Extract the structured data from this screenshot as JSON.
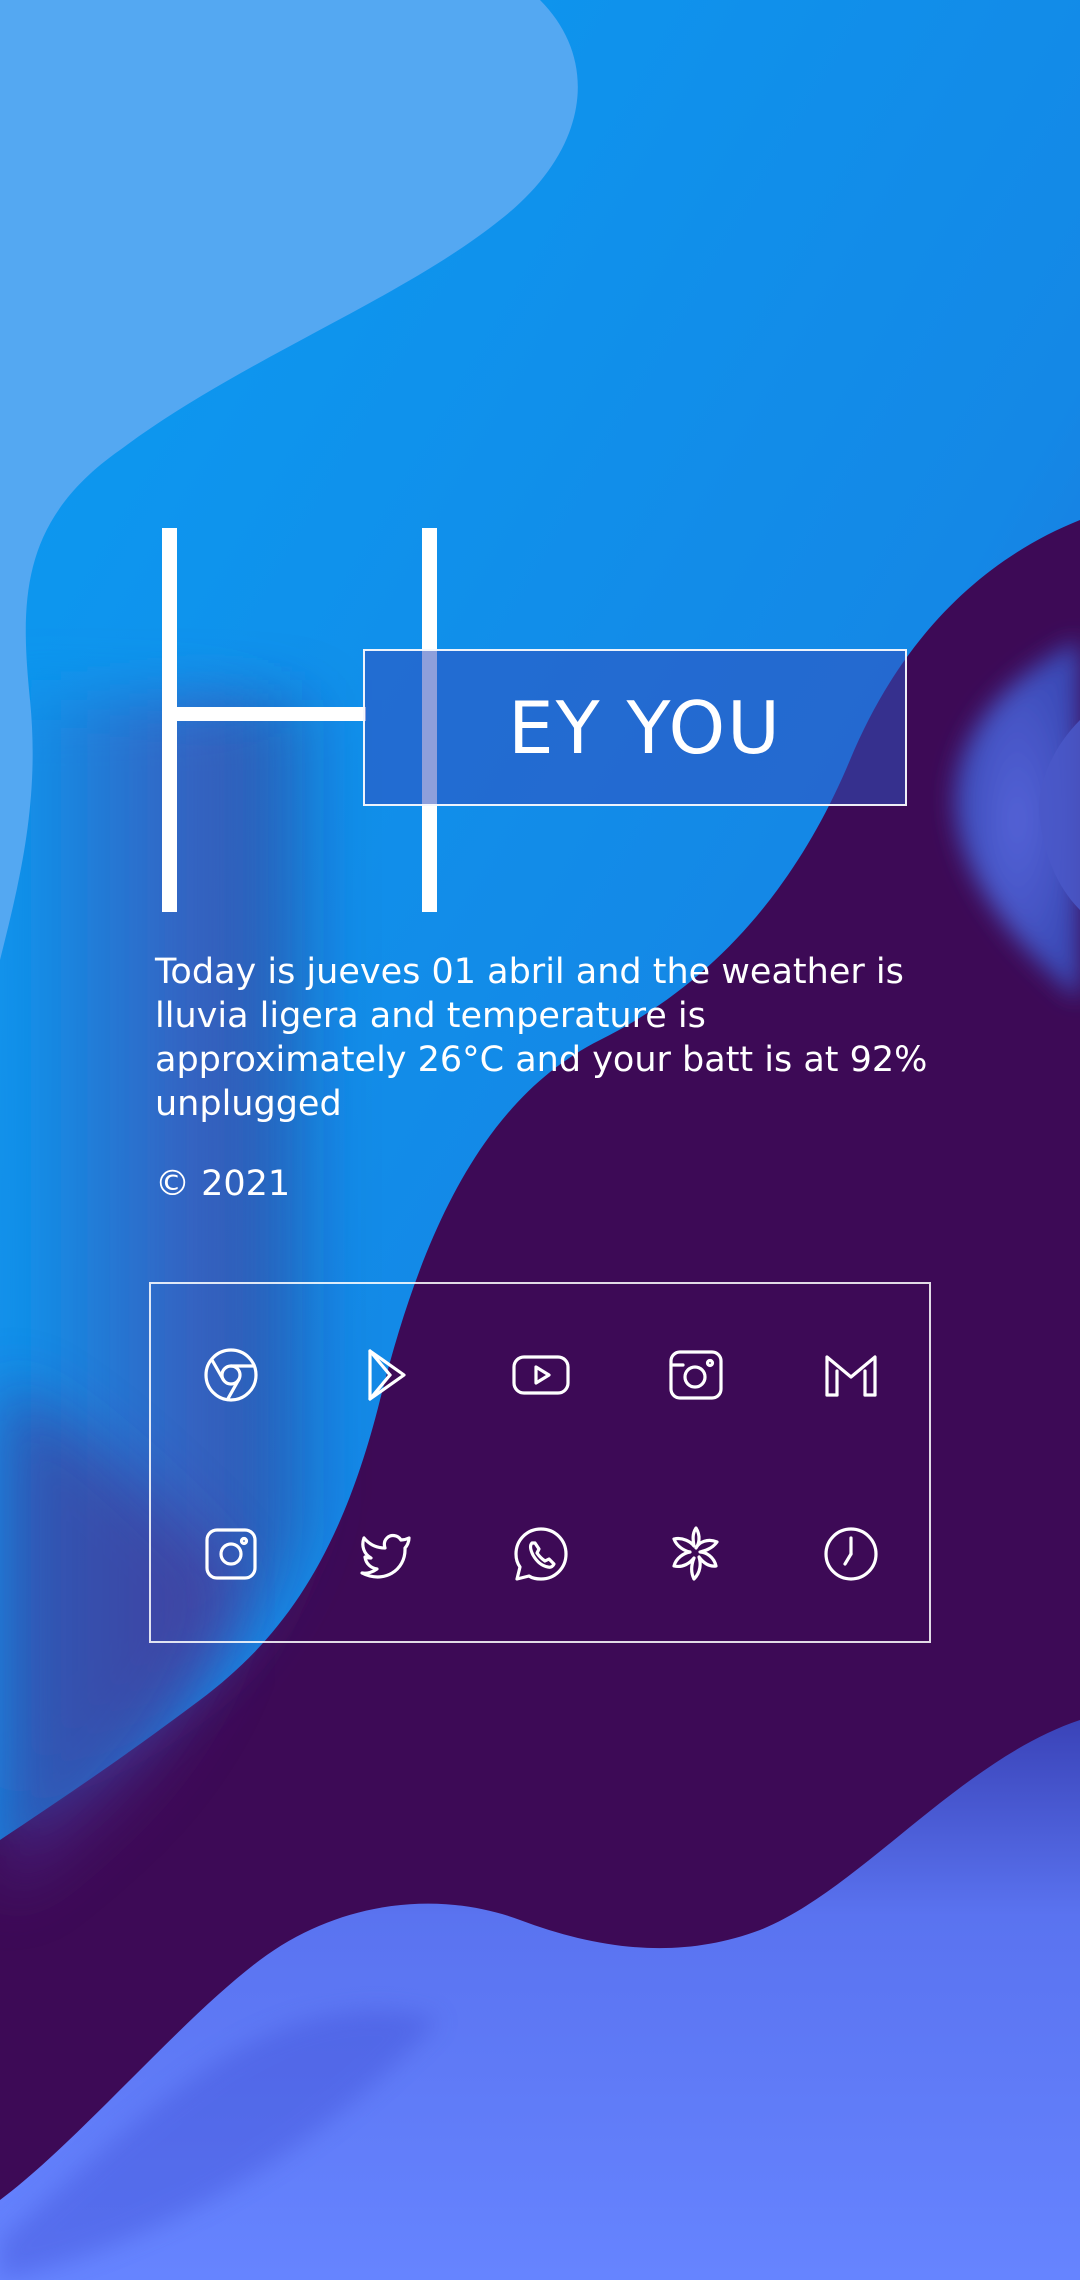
{
  "widget": {
    "hey_text": "EY YOU",
    "info_text": "Today is  jueves 01 abril and the weather is lluvia ligera and temperature is approximately 26°C and your batt is at 92% unplugged",
    "copyright": "© 2021"
  },
  "dock": {
    "icons": [
      "chrome-icon",
      "play-store-icon",
      "youtube-icon",
      "camera-icon",
      "gmail-icon",
      "instagram-icon",
      "twitter-icon",
      "whatsapp-icon",
      "flower-app-icon",
      "clock-icon"
    ]
  },
  "colors": {
    "light_blue": "#4fa3f1",
    "bright_blue": "#0a97ef",
    "deep_purple": "#3d0a56",
    "periwinkle": "#6684ff",
    "white": "#ffffff"
  }
}
